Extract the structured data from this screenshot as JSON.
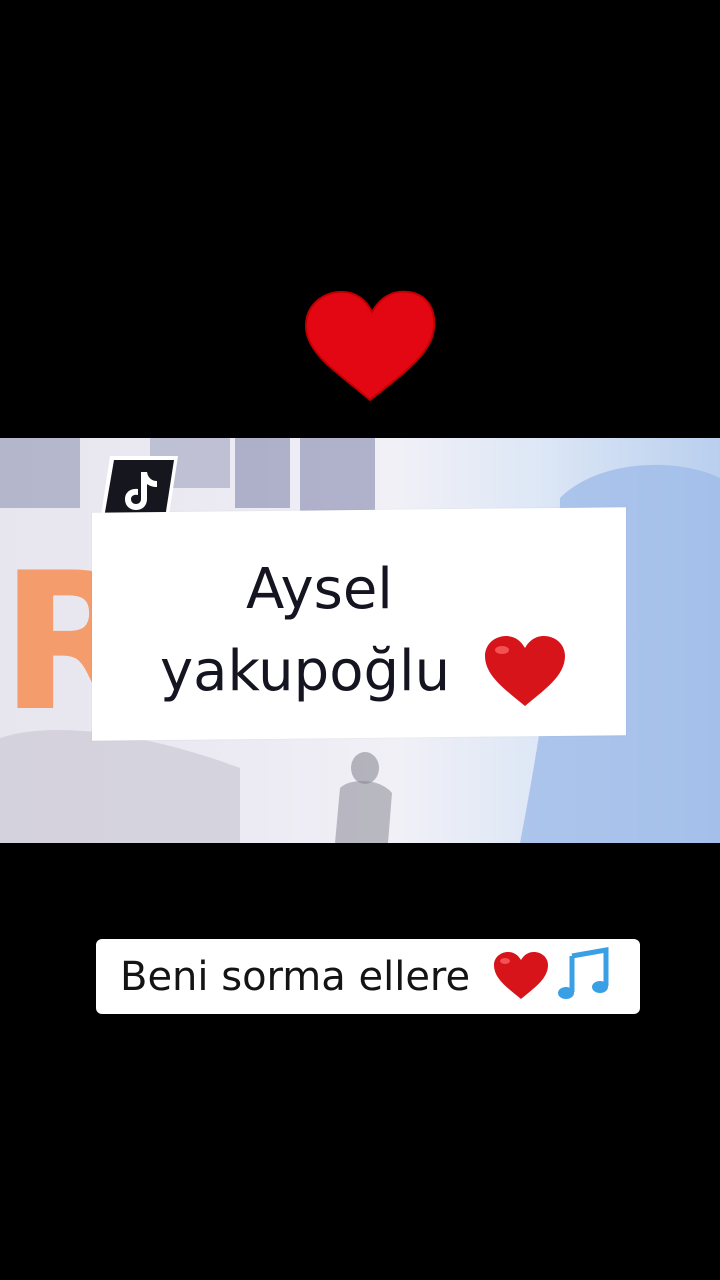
{
  "overlay": {
    "title_line1": "Aysel",
    "title_line2": "yakupoğlu",
    "caption": "Beni sorma ellere",
    "bg_letter": "R"
  },
  "icons": {
    "top_heart": "red-heart-icon",
    "title_heart": "red-heart-emoji-icon",
    "caption_heart": "red-heart-emoji-icon",
    "caption_note": "musical-notes-emoji-icon",
    "watermark": "tiktok-logo-icon"
  },
  "colors": {
    "background": "#000000",
    "heart": "#e30613",
    "card": "#ffffff",
    "text": "#151522",
    "note": "#3aa0e6"
  }
}
